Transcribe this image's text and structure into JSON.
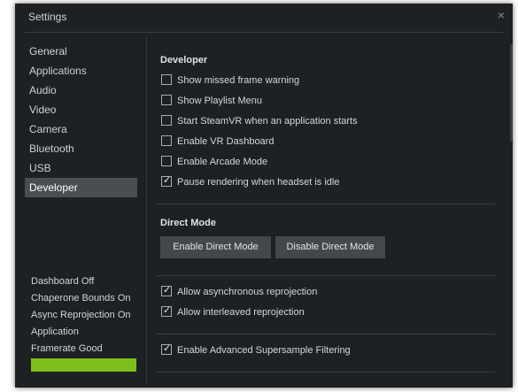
{
  "window": {
    "title": "Settings",
    "close_glyph": "×"
  },
  "sidebar": {
    "items": [
      {
        "label": "General",
        "active": false
      },
      {
        "label": "Applications",
        "active": false
      },
      {
        "label": "Audio",
        "active": false
      },
      {
        "label": "Video",
        "active": false
      },
      {
        "label": "Camera",
        "active": false
      },
      {
        "label": "Bluetooth",
        "active": false
      },
      {
        "label": "USB",
        "active": false
      },
      {
        "label": "Developer",
        "active": true
      }
    ]
  },
  "status": {
    "lines": [
      "Dashboard Off",
      "Chaperone Bounds On",
      "Async Reprojection On",
      "Application",
      "Framerate Good"
    ],
    "indicator_color": "#7dbf19"
  },
  "developer": {
    "heading": "Developer",
    "options": [
      {
        "label": "Show missed frame warning",
        "checked": false
      },
      {
        "label": "Show Playlist Menu",
        "checked": false
      },
      {
        "label": "Start SteamVR when an application starts",
        "checked": false
      },
      {
        "label": "Enable VR Dashboard",
        "checked": false
      },
      {
        "label": "Enable Arcade Mode",
        "checked": false
      },
      {
        "label": "Pause rendering when headset is idle",
        "checked": true
      }
    ]
  },
  "direct_mode": {
    "heading": "Direct Mode",
    "enable_label": "Enable Direct Mode",
    "disable_label": "Disable Direct Mode"
  },
  "reprojection": {
    "options": [
      {
        "label": "Allow asynchronous reprojection",
        "checked": true
      },
      {
        "label": "Allow interleaved reprojection",
        "checked": true
      }
    ]
  },
  "supersample": {
    "options": [
      {
        "label": "Enable Advanced Supersample Filtering",
        "checked": true
      }
    ]
  },
  "check_glyph": "✓"
}
